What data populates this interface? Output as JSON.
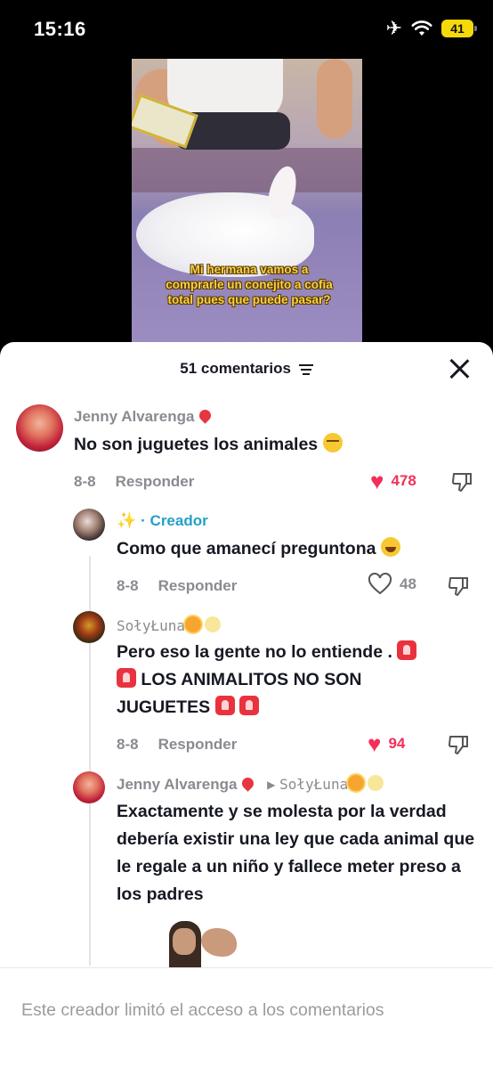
{
  "status_bar": {
    "time": "15:16",
    "battery": "41",
    "airplane_icon": "airplane-icon",
    "wifi_icon": "wifi-icon"
  },
  "video": {
    "caption": "Mi hermana vamos a comprarle un conejito a cofia total pues que puede pasar?"
  },
  "sheet": {
    "title": "51 comentarios",
    "filter_icon": "sort-icon",
    "close_icon": "close-icon"
  },
  "comments": [
    {
      "username": "Jenny Alvarenga",
      "text": "No son juguetes los animales",
      "emoji": "unamused",
      "date": "8-8",
      "reply_label": "Responder",
      "likes": "478",
      "liked": true,
      "accent": "#f2305a"
    },
    {
      "username_suffix": "· Creador",
      "text": "Como que amanecí preguntona",
      "emoji": "laughing",
      "date": "8-8",
      "reply_label": "Responder",
      "likes": "48",
      "liked": false,
      "accent": "#23a0c7"
    },
    {
      "username": "SołyŁuna",
      "text_line1": "Pero eso la gente no lo entiende .",
      "text_line2": "LOS ANIMALITOS NO SON",
      "text_line3": "JUGUETES",
      "date": "8-8",
      "reply_label": "Responder",
      "likes": "94",
      "liked": true
    },
    {
      "username": "Jenny Alvarenga",
      "reply_to": "SołyŁuna",
      "text": "Exactamente y se molesta por la verdad debería existir una ley que cada animal que le regale a un niño y fallece meter preso a los padres",
      "has_gif": true
    }
  ],
  "footer": {
    "notice": "Este creador limitó el acceso a los comentarios"
  }
}
